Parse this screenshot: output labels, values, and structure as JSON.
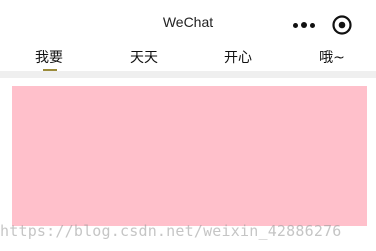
{
  "nav": {
    "title": "WeChat",
    "more_icon": "more-dots-icon",
    "close_icon": "target-close-icon"
  },
  "tabs": [
    {
      "label": "我要",
      "selected": true
    },
    {
      "label": "天天",
      "selected": false
    },
    {
      "label": "开心",
      "selected": false
    },
    {
      "label": "哦~",
      "selected": false
    }
  ],
  "content": {
    "block_color": "#ffc0cb"
  },
  "watermark": {
    "text": "https://blog.csdn.net/weixin_42886276"
  },
  "colors": {
    "active_underline": "#9a8a3a",
    "divider": "#efefef",
    "content_block": "#ffc0cb"
  }
}
